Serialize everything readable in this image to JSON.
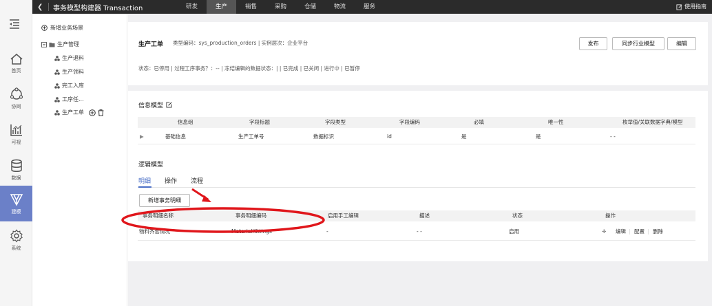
{
  "topbar": {
    "back_icon": "chevron-left-icon",
    "app_title": "事务模型构建器 Transaction",
    "tabs": [
      {
        "label": "研发",
        "active": false
      },
      {
        "label": "生产",
        "active": true
      },
      {
        "label": "销售",
        "active": false
      },
      {
        "label": "采购",
        "active": false
      },
      {
        "label": "仓储",
        "active": false
      },
      {
        "label": "物流",
        "active": false
      },
      {
        "label": "服务",
        "active": false
      }
    ],
    "guide_label": "使用指南"
  },
  "leftnav": {
    "items": [
      {
        "label": "首页",
        "icon": "home-icon"
      },
      {
        "label": "协同",
        "icon": "share-icon"
      },
      {
        "label": "可视",
        "icon": "chart-icon"
      },
      {
        "label": "数据",
        "icon": "database-icon"
      },
      {
        "label": "建模",
        "icon": "model-icon",
        "active": true
      },
      {
        "label": "系统",
        "icon": "gear-icon"
      }
    ]
  },
  "tree": {
    "add_scene": "新增业务场景",
    "root": "生产管理",
    "children": [
      "生产退料",
      "生产领料",
      "完工入库",
      "工序任...",
      "生产工单"
    ]
  },
  "header": {
    "title": "生产工单",
    "meta": "类型编码：sys_production_orders  |  实例层次：企业平台",
    "status_line": "状态：已停用  |  过程工序事务？：-- |  冻结编辑的数据状态：| | 已完成 | 已关闭 | 进行中 | 已暂停",
    "buttons": {
      "publish": "发布",
      "sync": "同步行业模型",
      "edit": "编辑"
    }
  },
  "info_model": {
    "title": "信息模型",
    "columns": [
      "信息组",
      "字段标题",
      "字段类型",
      "字段编码",
      "必填",
      "唯一性",
      "枚举值/关联数据字典/模型"
    ],
    "rows": [
      [
        "基础信息",
        "生产工单号",
        "数据标识",
        "id",
        "是",
        "是",
        "- -"
      ]
    ]
  },
  "logic_model": {
    "title": "逻辑模型",
    "tabs": [
      "明细",
      "操作",
      "流程"
    ],
    "add_button": "新增事务明细",
    "columns": [
      "事务明细名称",
      "事务明细编码",
      "启用手工编辑",
      "描述",
      "状态",
      "操作"
    ],
    "rows": [
      {
        "name": "物料齐套情况",
        "code": "MaterialKittings",
        "manual": "-",
        "desc": "- -",
        "status": "启用",
        "actions": [
          "编辑",
          "配置",
          "删除"
        ]
      }
    ]
  },
  "colors": {
    "accent": "#4a6fc7",
    "nav_active": "#6b80c8",
    "annotation": "#e0161b"
  }
}
